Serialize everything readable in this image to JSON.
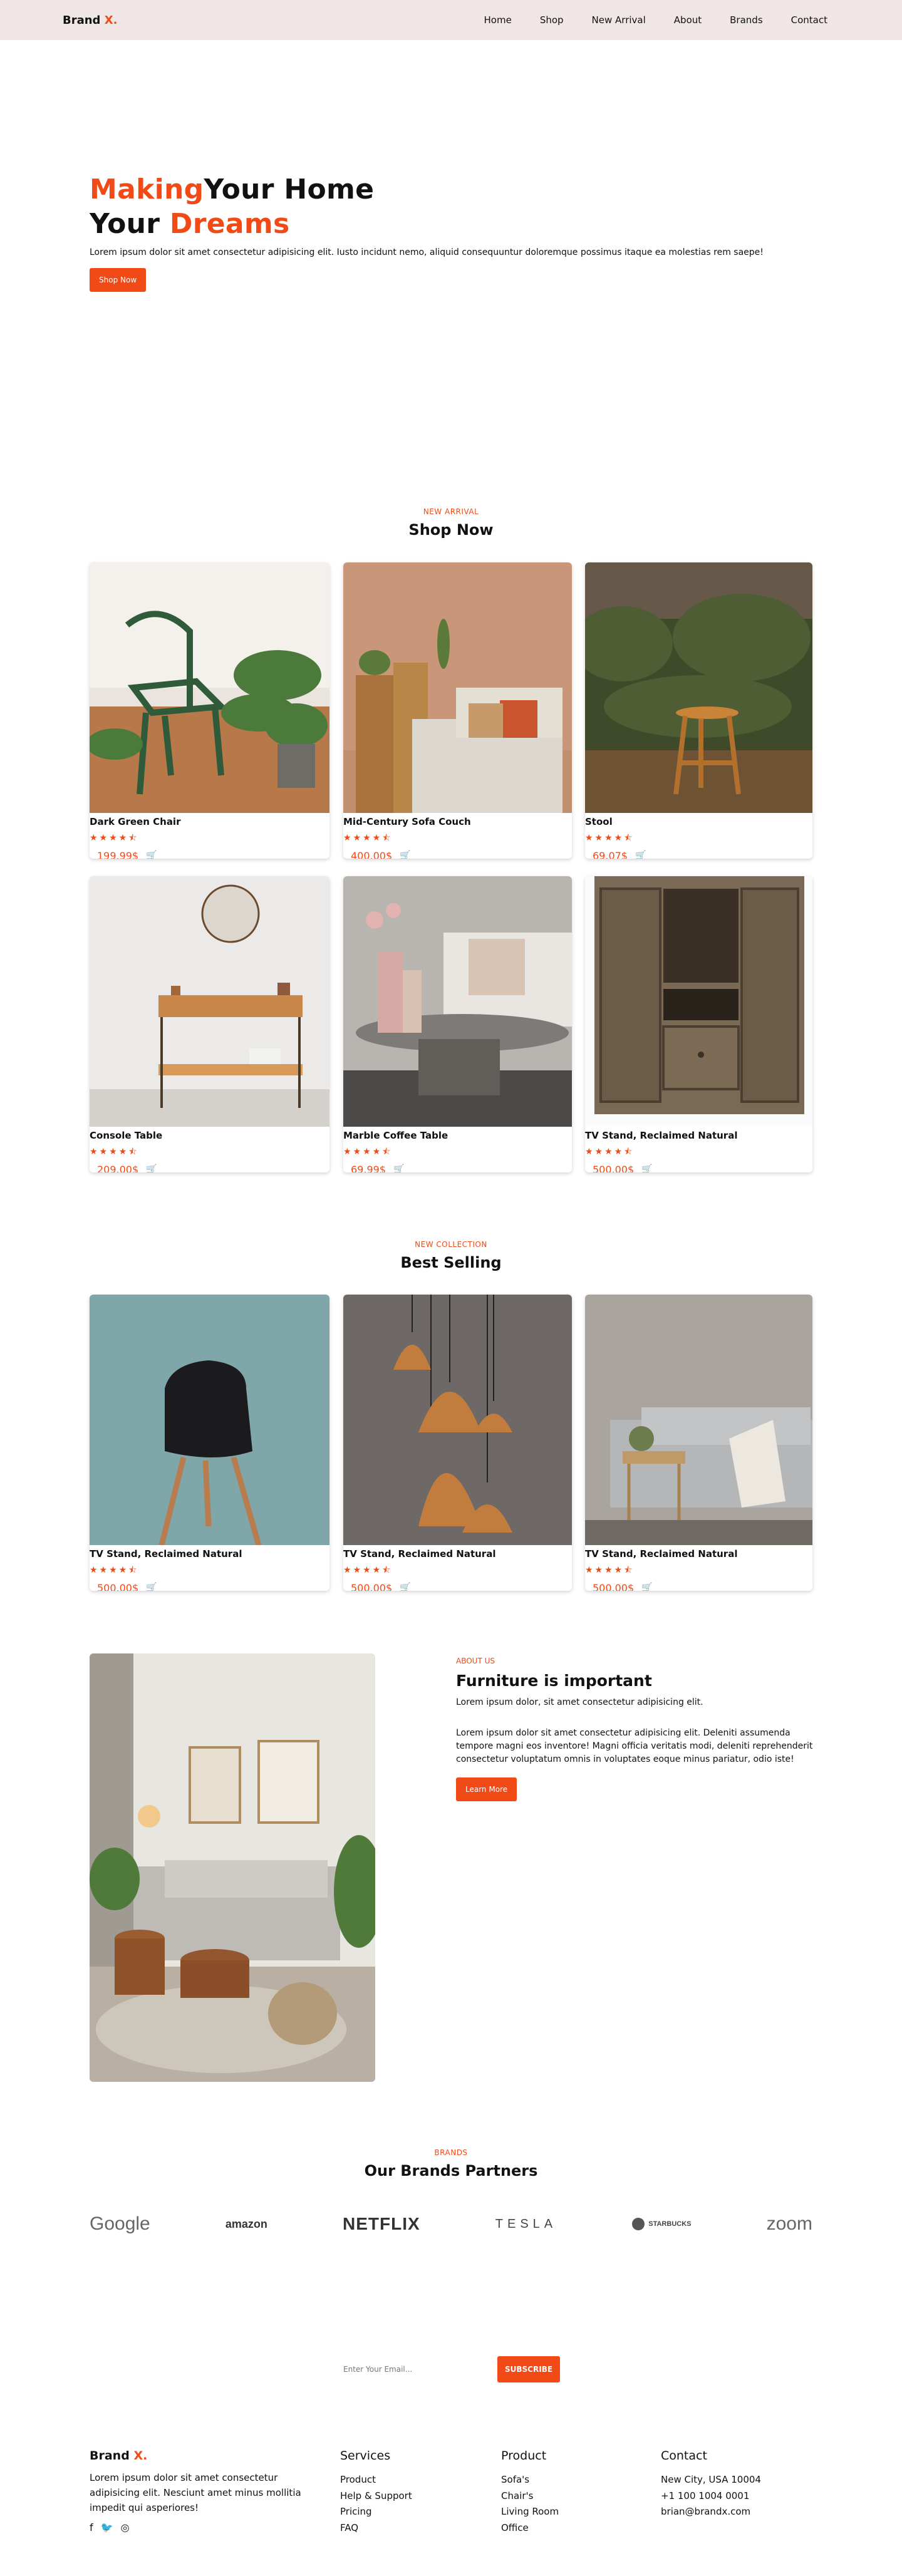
{
  "nav": {
    "brand": "Brand",
    "brand_x": "X.",
    "items": [
      "Home",
      "Shop",
      "New Arrival",
      "About",
      "Brands",
      "Contact"
    ]
  },
  "hero": {
    "title_1a": "Making",
    "title_1b": "Your Home",
    "title_2a": "Your ",
    "title_2b": "Dreams",
    "text": "Lorem ipsum dolor sit amet consectetur adipisicing elit. Iusto incidunt nemo, aliquid consequuntur doloremque possimus itaque ea molestias rem saepe!",
    "button": "Shop Now"
  },
  "shop": {
    "kicker": "NEW ARRIVAL",
    "title": "Shop Now",
    "products": [
      {
        "name": "Dark Green Chair",
        "stars": "★★★★⯪",
        "price": "199.99$",
        "cart": "🛒"
      },
      {
        "name": "Mid-Century Sofa Couch",
        "stars": "★★★★⯪",
        "price": "400.00$",
        "cart": "🛒"
      },
      {
        "name": "Stool",
        "stars": "★★★★⯪",
        "price": "69.07$",
        "cart": "🛒"
      },
      {
        "name": "Console Table",
        "stars": "★★★★⯪",
        "price": "209.00$",
        "cart": "🛒"
      },
      {
        "name": "Marble Coffee Table",
        "stars": "★★★★⯪",
        "price": "69.99$",
        "cart": "🛒"
      },
      {
        "name": "TV Stand, Reclaimed Natural",
        "stars": "★★★★⯪",
        "price": "500.00$",
        "cart": "🛒"
      }
    ]
  },
  "best": {
    "kicker": "NEW COLLECTION",
    "title": "Best Selling",
    "products": [
      {
        "name": "TV Stand, Reclaimed Natural",
        "stars": "★★★★⯪",
        "price": "500.00$",
        "cart": "🛒"
      },
      {
        "name": "TV Stand, Reclaimed Natural",
        "stars": "★★★★⯪",
        "price": "500.00$",
        "cart": "🛒"
      },
      {
        "name": "TV Stand, Reclaimed Natural",
        "stars": "★★★★⯪",
        "price": "500.00$",
        "cart": "🛒"
      }
    ]
  },
  "about": {
    "kicker": "ABOUT US",
    "title": "Furniture is important",
    "p1": "Lorem ipsum dolor, sit amet consectetur adipisicing elit.",
    "p2": "Lorem ipsum dolor sit amet consectetur adipisicing elit. Deleniti assumenda tempore magni eos inventore! Magni officia veritatis modi, deleniti reprehenderit consectetur voluptatum omnis in voluptates eoque minus pariatur, odio iste!",
    "button": "Learn More"
  },
  "brands": {
    "kicker": "BRANDS",
    "title": "Our Brands Partners",
    "logos": [
      "Google",
      "amazon",
      "NETFLIX",
      "TESLA",
      "STARBUCKS",
      "zoom"
    ]
  },
  "subscribe": {
    "placeholder": "Enter Your Email...",
    "button": "SUBSCRIBE"
  },
  "footer": {
    "brand": "Brand",
    "brand_x": "X.",
    "desc": "Lorem ipsum dolor sit amet consectetur adipisicing elit. Nesciunt amet minus mollitia impedit qui asperiores!",
    "social_icons": [
      "facebook-icon",
      "twitter-icon",
      "instagram-icon"
    ],
    "services": {
      "title": "Services",
      "items": [
        "Product",
        "Help & Support",
        "Pricing",
        "FAQ"
      ]
    },
    "product": {
      "title": "Product",
      "items": [
        "Sofa's",
        "Chair's",
        "Living Room",
        "Office"
      ]
    },
    "contact": {
      "title": "Contact",
      "items": [
        "New City, USA 10004",
        "+1 100 1004 0001",
        "brian@brandx.com"
      ]
    }
  },
  "colors": {
    "accent": "#f14a16",
    "nav_bg": "#f0e6e5"
  }
}
